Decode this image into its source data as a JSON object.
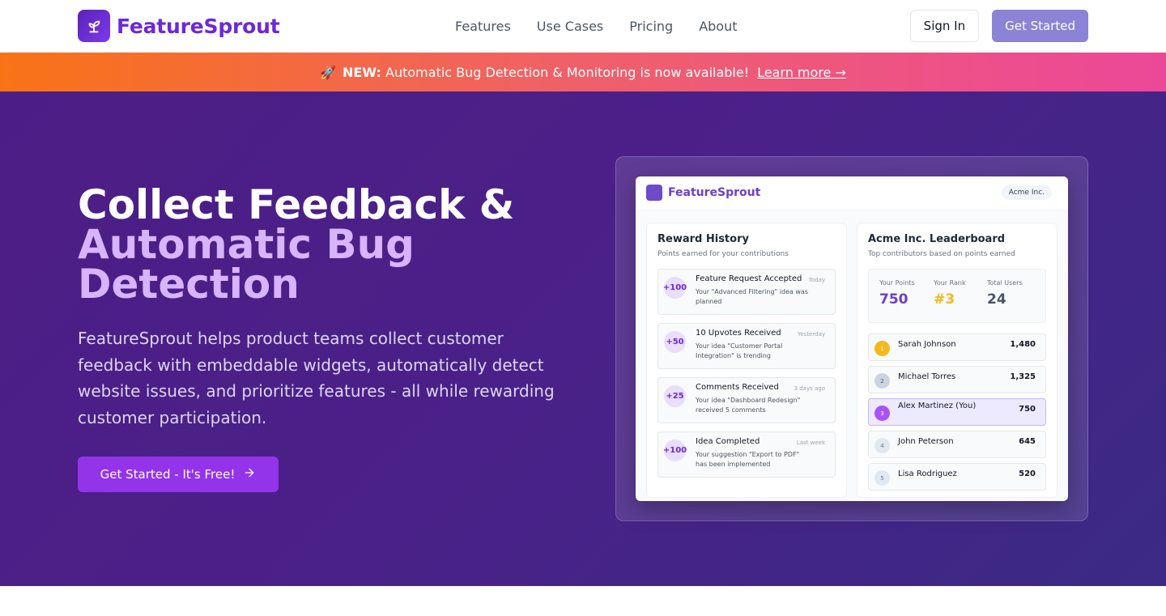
{
  "nav": {
    "brand": "FeatureSprout",
    "links": [
      "Features",
      "Use Cases",
      "Pricing",
      "About"
    ],
    "sign_in": "Sign In",
    "get_started": "Get Started"
  },
  "banner": {
    "icon": "rocket-icon",
    "new_label": "NEW:",
    "text": "Automatic Bug Detection & Monitoring is now available!",
    "link": "Learn more →"
  },
  "hero": {
    "title_line1": "Collect Feedback &",
    "title_accent": "Automatic Bug Detection",
    "description": "FeatureSprout helps product teams collect customer feedback with embeddable widgets, automatically detect website issues, and prioritize features - all while rewarding customer participation.",
    "cta": "Get Started - It's Free!"
  },
  "mock": {
    "brand": "FeatureSprout",
    "org": "Acme Inc.",
    "rewards": {
      "title": "Reward History",
      "subtitle": "Points earned for your contributions",
      "items": [
        {
          "points": "+100",
          "title": "Feature Request Accepted",
          "time": "Today",
          "desc": "Your \"Advanced Filtering\" idea was planned"
        },
        {
          "points": "+50",
          "title": "10 Upvotes Received",
          "time": "Yesterday",
          "desc": "Your idea \"Customer Portal Integration\" is trending"
        },
        {
          "points": "+25",
          "title": "Comments Received",
          "time": "3 days ago",
          "desc": "Your idea \"Dashboard Redesign\" received 5 comments"
        },
        {
          "points": "+100",
          "title": "Idea Completed",
          "time": "Last week",
          "desc": "Your suggestion \"Export to PDF\" has been implemented"
        }
      ]
    },
    "leaderboard": {
      "title": "Acme Inc. Leaderboard",
      "subtitle": "Top contributors based on points earned",
      "stats": [
        {
          "label": "Your Points",
          "value": "750",
          "color": "#6d3fc9"
        },
        {
          "label": "Your Rank",
          "value": "#3",
          "color": "#f5b81b"
        },
        {
          "label": "Total Users",
          "value": "24",
          "color": "#4b5563"
        }
      ],
      "rows": [
        {
          "rank": "1",
          "name": "Sarah Johnson",
          "score": "1,480"
        },
        {
          "rank": "2",
          "name": "Michael Torres",
          "score": "1,325"
        },
        {
          "rank": "3",
          "name": "Alex Martinez (You)",
          "score": "750"
        },
        {
          "rank": "4",
          "name": "John Peterson",
          "score": "645"
        },
        {
          "rank": "5",
          "name": "Lisa Rodriguez",
          "score": "520"
        }
      ]
    }
  },
  "colors": {
    "brand_purple": "#6d28d9",
    "cta_purple": "#9333ea",
    "accent_lavender": "#d8b4fe",
    "gold": "#f5b81b"
  }
}
